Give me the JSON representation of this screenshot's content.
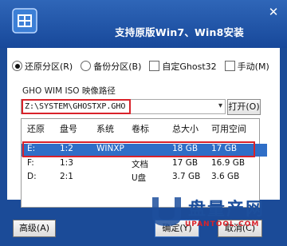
{
  "window": {
    "title": "支持原版Win7、Win8安装",
    "close_glyph": "✕"
  },
  "modes": [
    {
      "label": "还原分区(R)",
      "type": "radio",
      "checked": true
    },
    {
      "label": "备份分区(B)",
      "type": "radio",
      "checked": false
    },
    {
      "label": "自定Ghost32",
      "type": "checkbox",
      "checked": false
    },
    {
      "label": "手动(M)",
      "type": "checkbox",
      "checked": false
    }
  ],
  "path": {
    "label": "GHO WIM ISO 映像路径",
    "value": "Z:\\SYSTEM\\GHOSTXP.GHO",
    "dropdown_icon": "chevron-down-icon",
    "open_label": "打开(O)"
  },
  "table": {
    "columns": [
      "还原",
      "盘号",
      "系统",
      "卷标",
      "总大小",
      "可用空间"
    ],
    "rows": [
      {
        "cells": [
          "E:",
          "1:2",
          "WINXP",
          "",
          "18 GB",
          "17 GB"
        ],
        "selected": true
      },
      {
        "cells": [
          "F:",
          "1:3",
          "",
          "文档",
          "17 GB",
          "16.9 GB"
        ],
        "selected": false
      },
      {
        "cells": [
          "D:",
          "2:1",
          "",
          "U盘",
          "3.7 GB",
          "3.6 GB"
        ],
        "selected": false
      }
    ]
  },
  "buttons": {
    "advanced": "高级(A)",
    "ok": "确定(Y)",
    "cancel": "取消(C)"
  },
  "watermark": {
    "text": "盘量产网",
    "sub": "UPANTOOL.COM"
  },
  "colors": {
    "frame": "#1b4b98",
    "selection": "#2f6ec7",
    "highlight": "#d9222a"
  }
}
